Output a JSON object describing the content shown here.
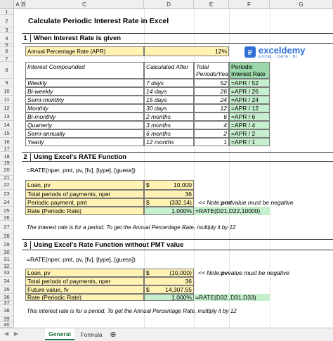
{
  "columns": [
    "A",
    "B",
    "C",
    "D",
    "E",
    "F",
    "G"
  ],
  "title": "Calculate Periodic Interest Rate in Excel",
  "logo": {
    "name": "exceldemy",
    "tagline": "EXCEL · DATA · BI"
  },
  "sec1": {
    "num": "1",
    "label": "When Interest Rate is given",
    "apr_label": "Annual Percentage Rate (APR)",
    "apr_value": "12%",
    "headers": [
      "Interest Compounded",
      "Calculated After",
      "Total Periods/Year",
      "Periodic Interest Rate"
    ],
    "rows": [
      {
        "c": "Weekly",
        "d": "7 days",
        "e": "52",
        "f": "=APR / 52"
      },
      {
        "c": "Bi-weekly",
        "d": "14 days",
        "e": "26",
        "f": "=APR / 26"
      },
      {
        "c": "Semi-monthly",
        "d": "15 days",
        "e": "24",
        "f": "=APR / 24"
      },
      {
        "c": "Monthly",
        "d": "30 days",
        "e": "12",
        "f": "=APR / 12"
      },
      {
        "c": "Bi-monthly",
        "d": "2 months",
        "e": "6",
        "f": "=APR / 6"
      },
      {
        "c": "Quarterly",
        "d": "3 months",
        "e": "4",
        "f": "=APR / 4"
      },
      {
        "c": "Semi-annually",
        "d": "6 months",
        "e": "2",
        "f": "=APR / 2"
      },
      {
        "c": "Yearly",
        "d": "12 months",
        "e": "1",
        "f": "=APR / 1"
      }
    ]
  },
  "sec2": {
    "num": "2",
    "label": "Using Excel's RATE Function",
    "syntax": "=RATE(nper, pmt, pv, [fv], [type], [guess])",
    "loan_label": "Loan, pv",
    "loan_cur": "$",
    "loan_val": "10,000",
    "nper_label": "Total periods of payments, nper",
    "nper_val": "36",
    "pmt_label": "Periodic payment, pmt",
    "pmt_cur": "$",
    "pmt_val": "(332.14)",
    "note_pre": "<< Note: ",
    "note_bold": "pmt",
    "note_post": " value must be negative",
    "rate_label": "Rate (Periodic Rate)",
    "rate_val": "1.000%",
    "rate_formula": "=RATE(D21,D22,10000)",
    "footnote": "The interest rate is for a period. To get the Annual Percentage Rate, multiply it by 12"
  },
  "sec3": {
    "num": "3",
    "label": "Using Excel's Rate Function without PMT value",
    "syntax": "=RATE(nper, pmt, pv, [fv], [type], [guess])",
    "loan_label": "Loan, pv",
    "loan_cur": "$",
    "loan_val": "(10,000)",
    "note_pre": "<< Note: ",
    "note_bold": "pv",
    "note_post": " value must be negative",
    "nper_label": "Total periods of payments, nper",
    "nper_val": "36",
    "fv_label": "Future value, fv",
    "fv_cur": "$",
    "fv_val": "14,307.55",
    "rate_label": "Rate (Periodic Rate)",
    "rate_val": "1.000%",
    "rate_formula": "=RATE(D32,,D31,D33)",
    "footnote": "This interest rate is for a period. To get the Annual Percentage Rate, multiply it by 12"
  },
  "rows": [
    "1",
    "2",
    "3",
    "4",
    "5",
    "6",
    "7",
    "8",
    "9",
    "10",
    "11",
    "12",
    "13",
    "14",
    "15",
    "16",
    "17",
    "18",
    "19",
    "20",
    "21",
    "22",
    "23",
    "24",
    "25",
    "26",
    "27",
    "28",
    "29",
    "30",
    "31",
    "32",
    "33",
    "34",
    "35",
    "36",
    "37",
    "38",
    "39",
    "40"
  ],
  "tabs": {
    "active": "General",
    "other": "Formula"
  }
}
